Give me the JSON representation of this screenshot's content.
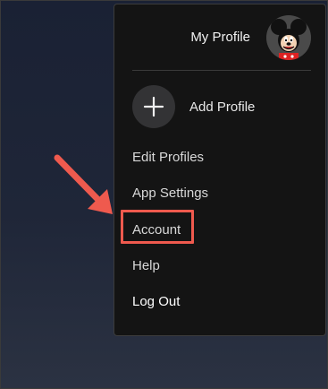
{
  "profile": {
    "name": "My Profile",
    "avatar_icon": "mickey-mouse-avatar"
  },
  "add_profile": {
    "label": "Add Profile",
    "icon": "plus-icon"
  },
  "menu": {
    "items": [
      {
        "label": "Edit Profiles"
      },
      {
        "label": "App Settings"
      },
      {
        "label": "Account"
      },
      {
        "label": "Help"
      },
      {
        "label": "Log Out"
      }
    ]
  },
  "annotation": {
    "highlighted_item": "Account",
    "color": "#ef5a4e"
  }
}
